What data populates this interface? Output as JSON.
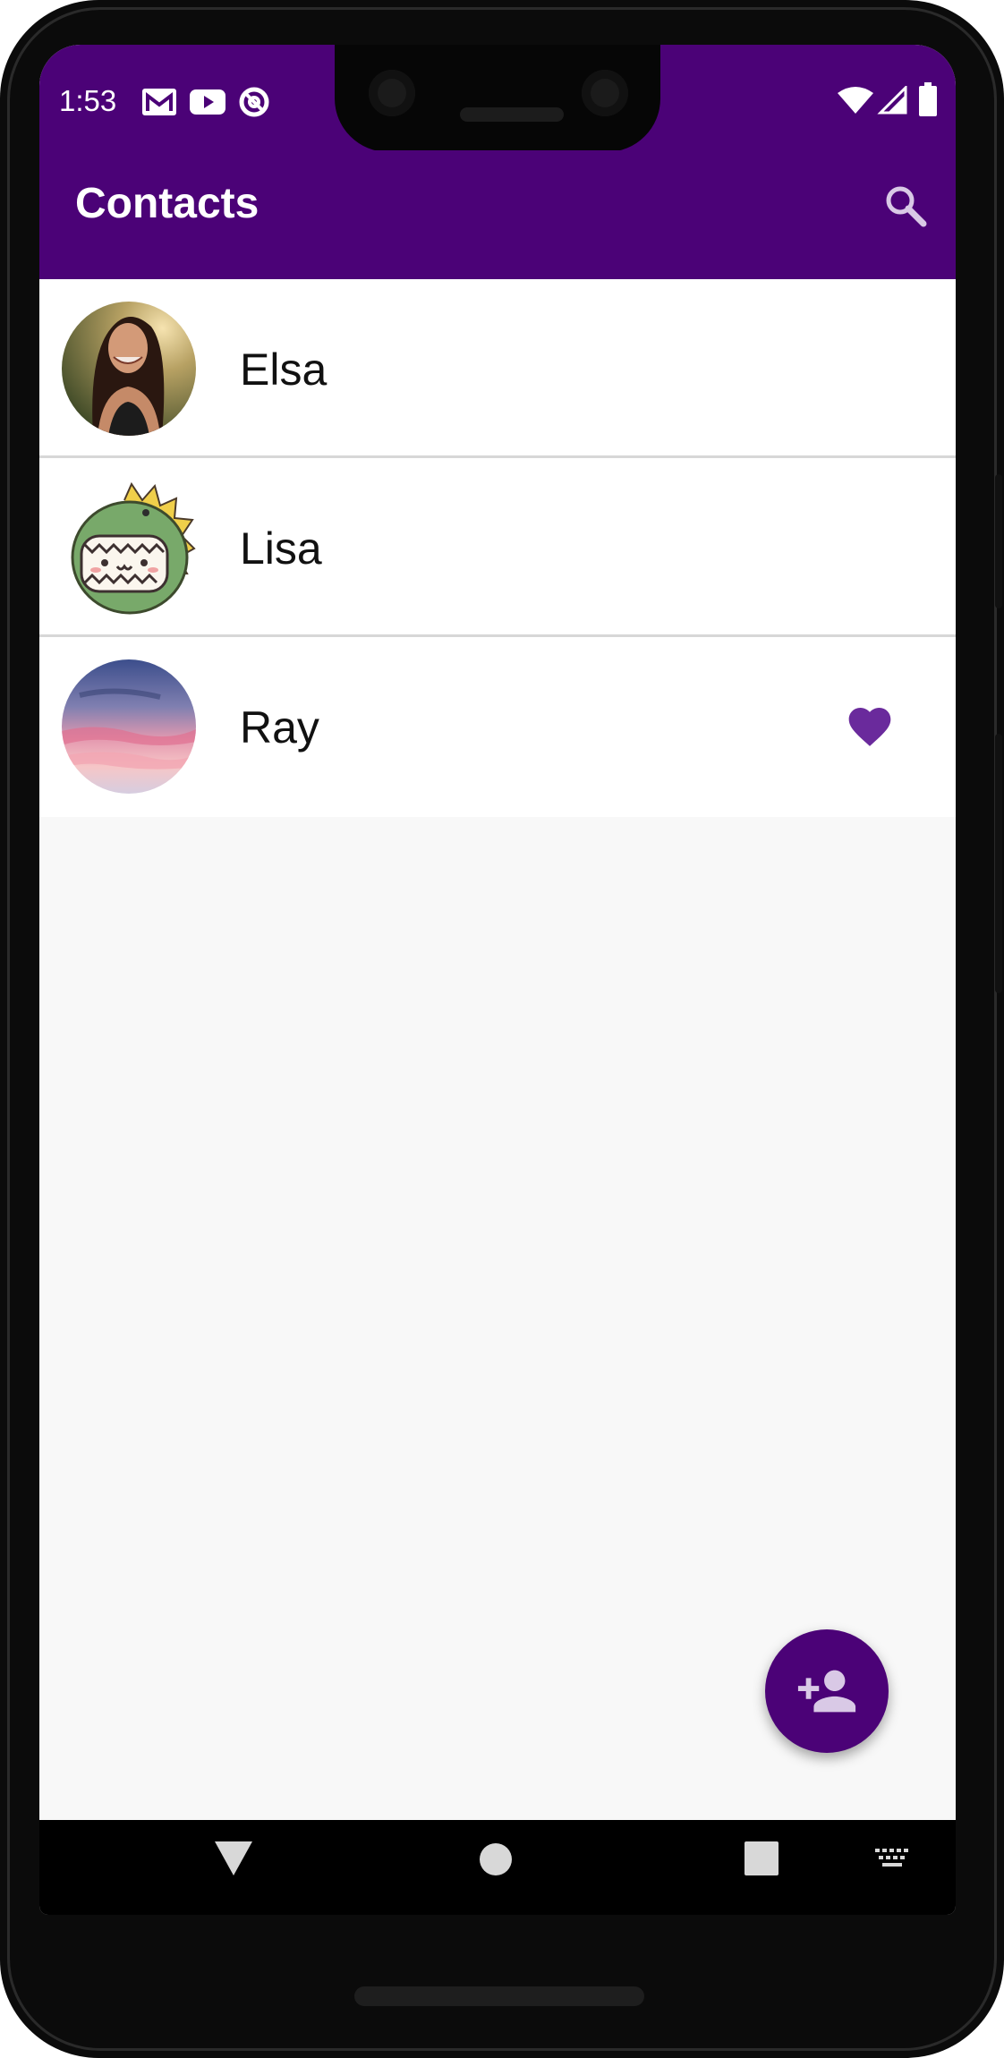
{
  "status_bar": {
    "time": "1:53",
    "notification_icons": [
      "gmail-icon",
      "youtube-icon",
      "data-saver-icon"
    ],
    "system_icons": [
      "wifi-icon",
      "signal-icon",
      "battery-icon"
    ]
  },
  "app_bar": {
    "title": "Contacts",
    "action_icon": "search-icon"
  },
  "contacts": [
    {
      "name": "Elsa",
      "avatar": "photo of smiling woman",
      "favorite": false
    },
    {
      "name": "Lisa",
      "avatar": "cartoon dinosaur",
      "favorite": false
    },
    {
      "name": "Ray",
      "avatar": "sunset sky",
      "favorite": true
    }
  ],
  "fab": {
    "icon": "person-add-icon"
  },
  "nav_bar": {
    "icons": [
      "back-icon",
      "home-icon",
      "recents-icon",
      "keyboard-icon"
    ]
  },
  "colors": {
    "primary": "#4b0277",
    "favorite": "#6a2a9c",
    "background": "#f8f8f8",
    "divider": "#d7d7d7"
  }
}
